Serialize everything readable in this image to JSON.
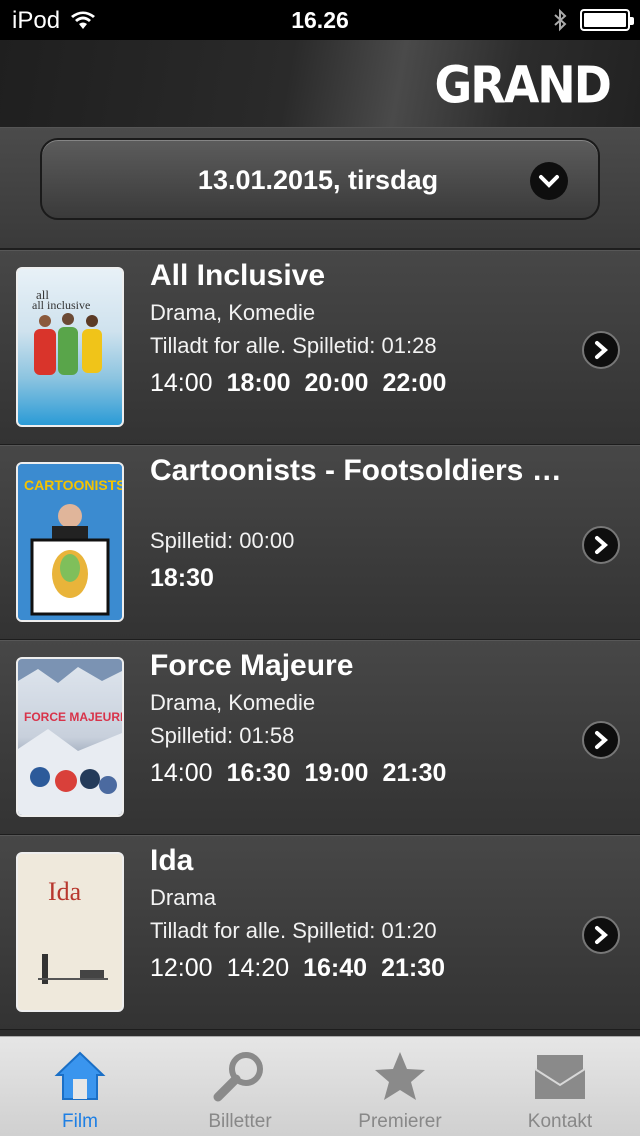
{
  "status": {
    "carrier": "iPod",
    "time": "16.26"
  },
  "header": {
    "logo": "GRAND"
  },
  "date_selector": {
    "value": "13.01.2015, tirsdag"
  },
  "movies": [
    {
      "title": "All Inclusive",
      "genre": "Drama, Komedie",
      "info": "Tilladt for alle. Spilletid: 01:28",
      "times": [
        "14:00",
        "18:00",
        "20:00",
        "22:00"
      ],
      "poster_text": "all inclusive"
    },
    {
      "title": "Cartoonists - Footsoldiers of Democracy",
      "genre": "",
      "info": "Spilletid: 00:00",
      "times": [
        "18:30"
      ],
      "poster_text": "CARTOONISTS"
    },
    {
      "title": "Force Majeure",
      "genre": "Drama, Komedie",
      "info": "Spilletid: 01:58",
      "times": [
        "14:00",
        "16:30",
        "19:00",
        "21:30"
      ],
      "poster_text": "FORCE MAJEURE"
    },
    {
      "title": "Ida",
      "genre": "Drama",
      "info": "Tilladt for alle. Spilletid: 01:20",
      "times": [
        "12:00",
        "14:20",
        "16:40",
        "21:30"
      ],
      "poster_text": "Ida"
    }
  ],
  "tabs": [
    {
      "label": "Film",
      "icon": "home-icon"
    },
    {
      "label": "Billetter",
      "icon": "search-icon"
    },
    {
      "label": "Premierer",
      "icon": "star-icon"
    },
    {
      "label": "Kontakt",
      "icon": "mail-icon"
    }
  ],
  "colors": {
    "active_tab": "#1e7fe4",
    "inactive_tab": "#888888"
  }
}
